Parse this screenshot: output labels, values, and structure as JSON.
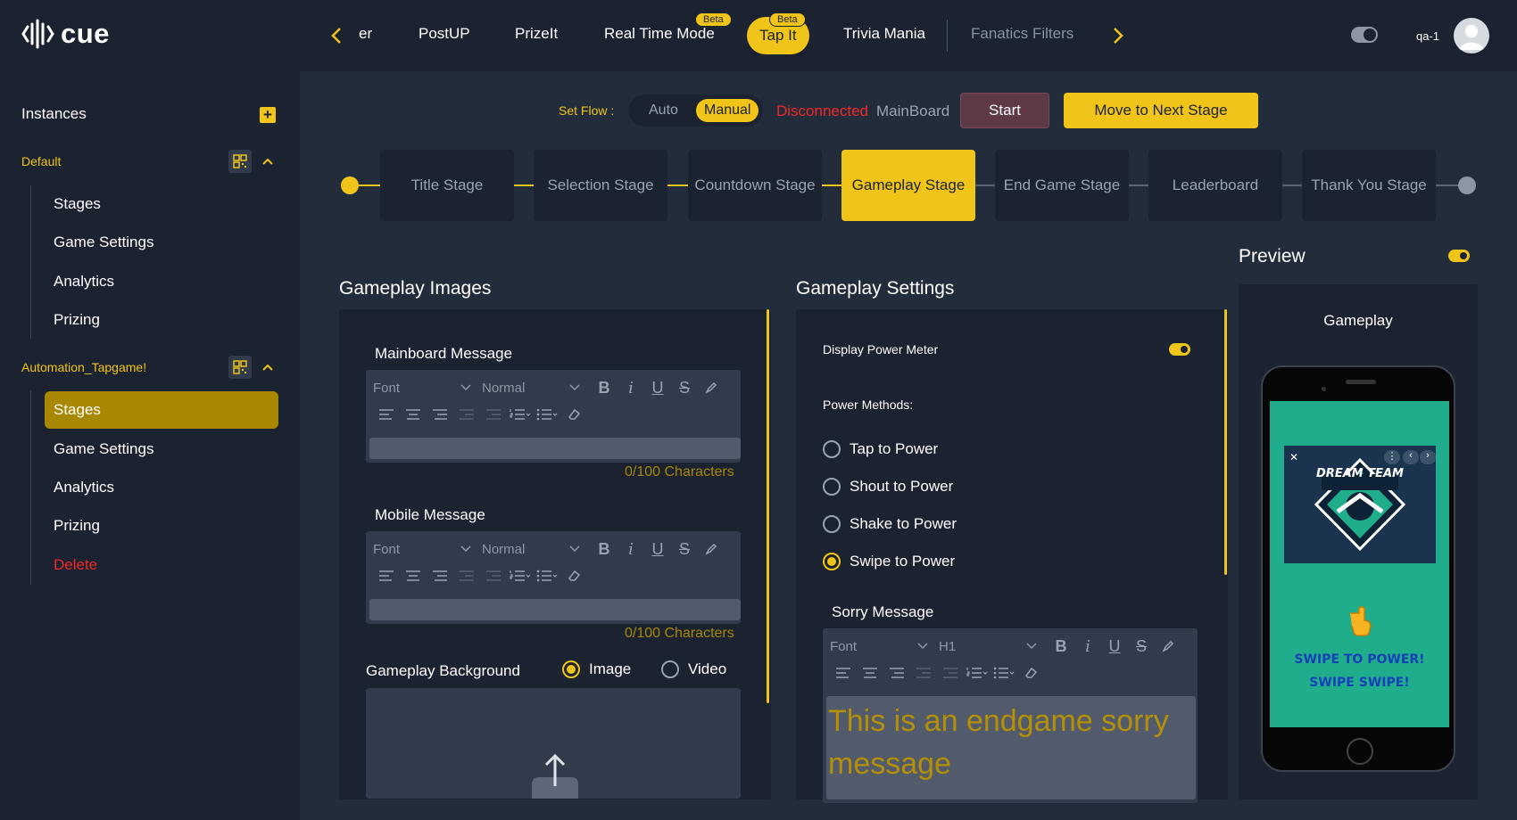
{
  "app": {
    "logo_text": "cue"
  },
  "top_tabs": {
    "items": [
      "er",
      "PostUP",
      "PrizeIt",
      "Real Time Mode",
      "Tap It",
      "Trivia Mania",
      "Fanatics Filters"
    ],
    "beta_label": "Beta",
    "active": "Tap It"
  },
  "user": {
    "name": "qa-1"
  },
  "sidebar": {
    "title": "Instances",
    "groups": [
      {
        "name": "Default",
        "items": [
          "Stages",
          "Game Settings",
          "Analytics",
          "Prizing"
        ]
      },
      {
        "name": "Automation_Tapgame!",
        "items": [
          "Stages",
          "Game Settings",
          "Analytics",
          "Prizing",
          "Delete"
        ],
        "active_item": "Stages"
      }
    ]
  },
  "controls": {
    "set_flow_label": "Set Flow :",
    "flow_options": [
      "Auto",
      "Manual"
    ],
    "flow_selected": "Manual",
    "connection_status": "Disconnected",
    "board_name": "MainBoard",
    "start_label": "Start",
    "next_stage_label": "Move to Next Stage"
  },
  "stages": {
    "items": [
      "Title Stage",
      "Selection Stage",
      "Countdown Stage",
      "Gameplay Stage",
      "End Game Stage",
      "Leaderboard",
      "Thank You Stage"
    ],
    "active": "Gameplay Stage"
  },
  "gameplay_images": {
    "title": "Gameplay Images",
    "mainboard_label": "Mainboard Message",
    "mobile_label": "Mobile Message",
    "font_placeholder": "Font",
    "size_normal": "Normal",
    "char_count": "0/100 Characters",
    "background_label": "Gameplay Background",
    "background_options": [
      "Image",
      "Video"
    ],
    "background_selected": "Image"
  },
  "gameplay_settings": {
    "title": "Gameplay Settings",
    "power_meter_label": "Display Power Meter",
    "power_meter_on": true,
    "power_methods_label": "Power Methods:",
    "power_methods": [
      "Tap to Power",
      "Shout to Power",
      "Shake to Power",
      "Swipe to Power"
    ],
    "power_selected": "Swipe to Power",
    "sorry_label": "Sorry Message",
    "sorry_font": "Font",
    "sorry_size": "H1",
    "sorry_text": "This is an endgame sorry message"
  },
  "preview": {
    "title": "Preview",
    "screen_label": "Gameplay",
    "promo_title": "DREAM TEAM",
    "swipe_line1": "SWIPE TO POWER!",
    "swipe_line2": "SWIPE SWIPE!"
  },
  "colors": {
    "accent": "#f0c419",
    "background": "#232c3b",
    "panel": "#1b2230",
    "danger": "#ef2828"
  }
}
